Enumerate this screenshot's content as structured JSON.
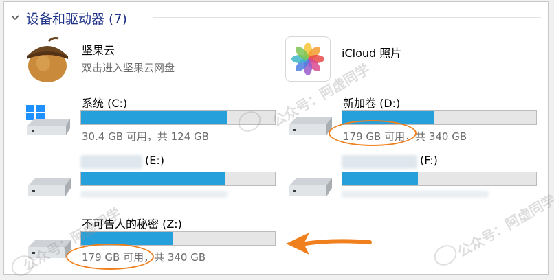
{
  "group": {
    "chevron": "chevron-down-icon",
    "title": "设备和驱动器 (7)"
  },
  "apps": [
    {
      "name": "坚果云",
      "subtitle": "双击进入坚果云网盘",
      "icon": "acorn-icon"
    },
    {
      "name": "iCloud 照片",
      "icon": "photos-icon"
    }
  ],
  "drives": [
    {
      "label": "系统 (C:)",
      "free": "30.4 GB 可用，共 124 GB",
      "used_fraction": 0.75,
      "icon": "windows-drive-icon"
    },
    {
      "label": "新加卷 (D:)",
      "free": "179 GB 可用，共 340 GB",
      "used_fraction": 0.47,
      "icon": "hard-drive-icon"
    },
    {
      "label": "(E:)",
      "free": "",
      "used_fraction": 0.74,
      "icon": "hard-drive-icon"
    },
    {
      "label": "(F:)",
      "free": "",
      "used_fraction": 0.39,
      "icon": "hard-drive-icon"
    },
    {
      "label": "不可告人的秘密 (Z:)",
      "free": "179 GB 可用，共 340 GB",
      "used_fraction": 0.47,
      "icon": "hard-drive-icon"
    }
  ],
  "watermark": "公众号：阿虚同学",
  "colors": {
    "accent": "#26a0da",
    "header": "#1e3287",
    "annotation": "#f0801e"
  }
}
